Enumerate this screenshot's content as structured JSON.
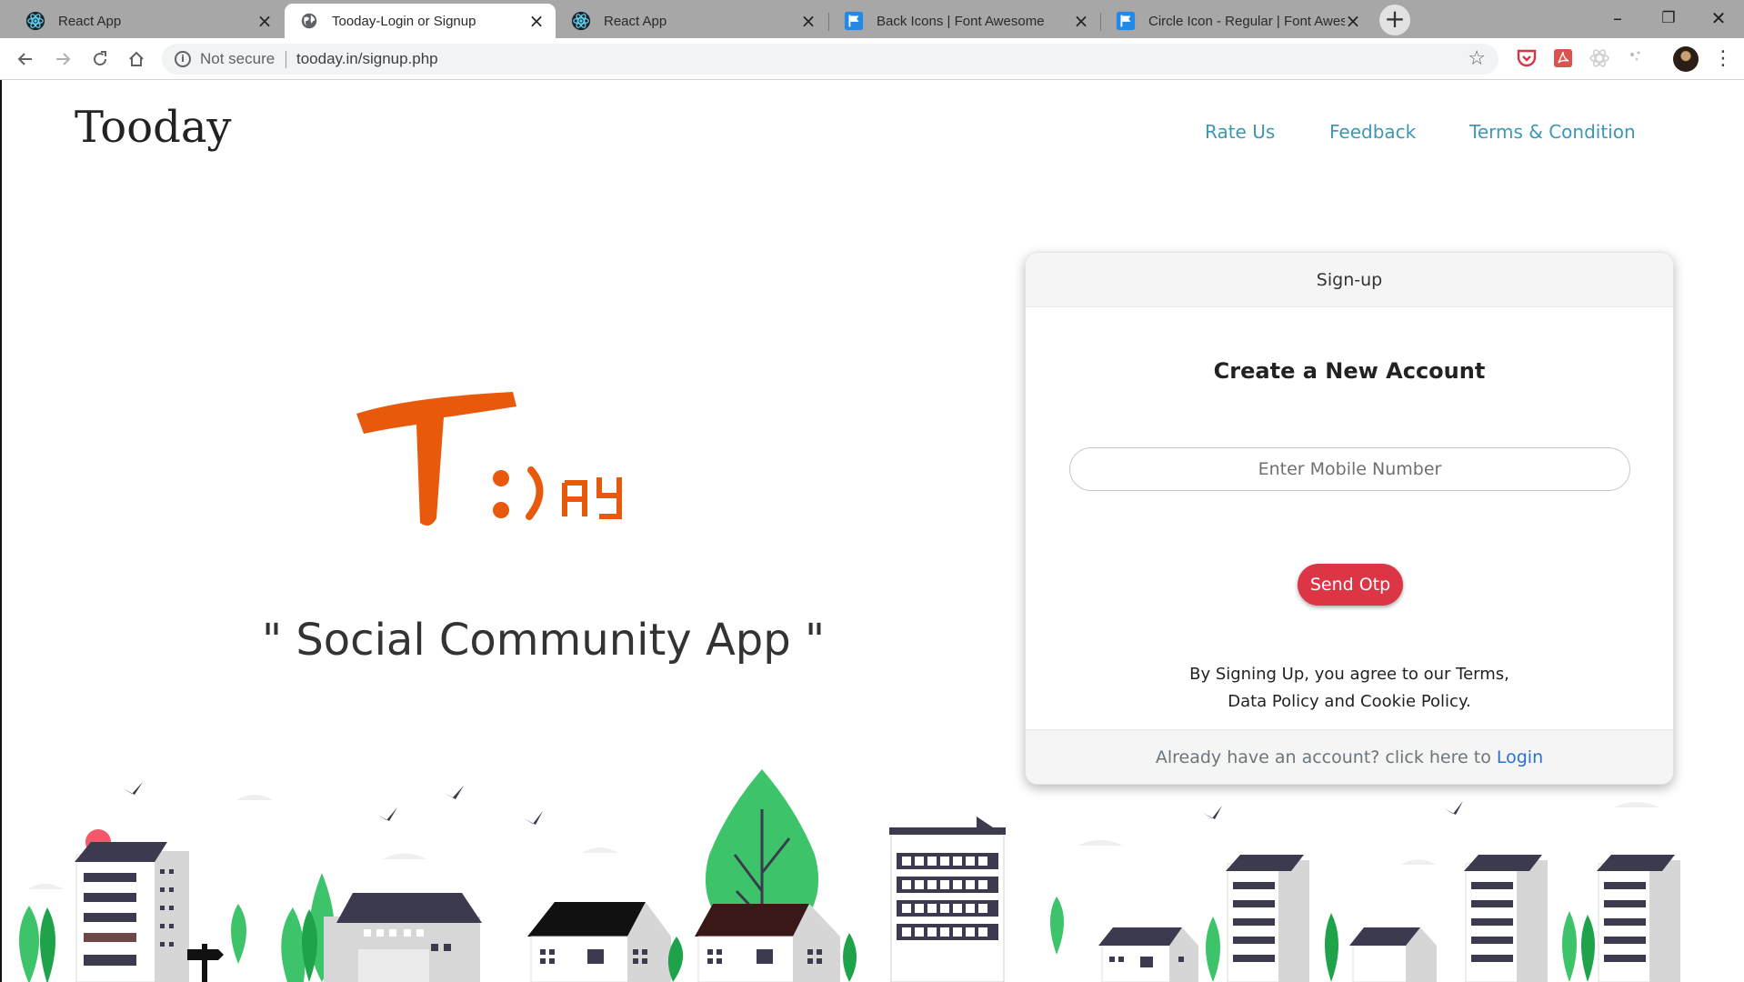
{
  "browser": {
    "tabs": [
      {
        "title": "React App",
        "icon": "react-icon",
        "active": false
      },
      {
        "title": "Tooday-Login or Signup",
        "icon": "globe-icon",
        "active": true
      },
      {
        "title": "React App",
        "icon": "react-icon",
        "active": false
      },
      {
        "title": "Back Icons | Font Awesome",
        "icon": "font-awesome-flag-icon",
        "active": false
      },
      {
        "title": "Circle Icon - Regular | Font Awesome",
        "icon": "font-awesome-flag-icon",
        "active": false
      }
    ],
    "security_label": "Not secure",
    "url": "tooday.in/signup.php"
  },
  "page": {
    "brand": "Tooday",
    "nav": {
      "rate_us": "Rate Us",
      "feedback": "Feedback",
      "terms": "Terms & Condition"
    },
    "logo_text": "T:)AY",
    "tagline": "\" Social Community App \"",
    "colors": {
      "accent": "#e8590c",
      "link": "#3d97b3",
      "button": "#dc3545",
      "login_link": "#2b6fd1",
      "tree": "#3dc46a"
    }
  },
  "signup": {
    "header": "Sign-up",
    "heading": "Create a New Account",
    "mobile_placeholder": "Enter Mobile Number",
    "button": "Send Otp",
    "agreement_line1": "By Signing Up, you agree to our Terms,",
    "agreement_line2": "Data Policy and Cookie Policy.",
    "footer_text": "Already have an account? click here to",
    "footer_link": "Login"
  }
}
